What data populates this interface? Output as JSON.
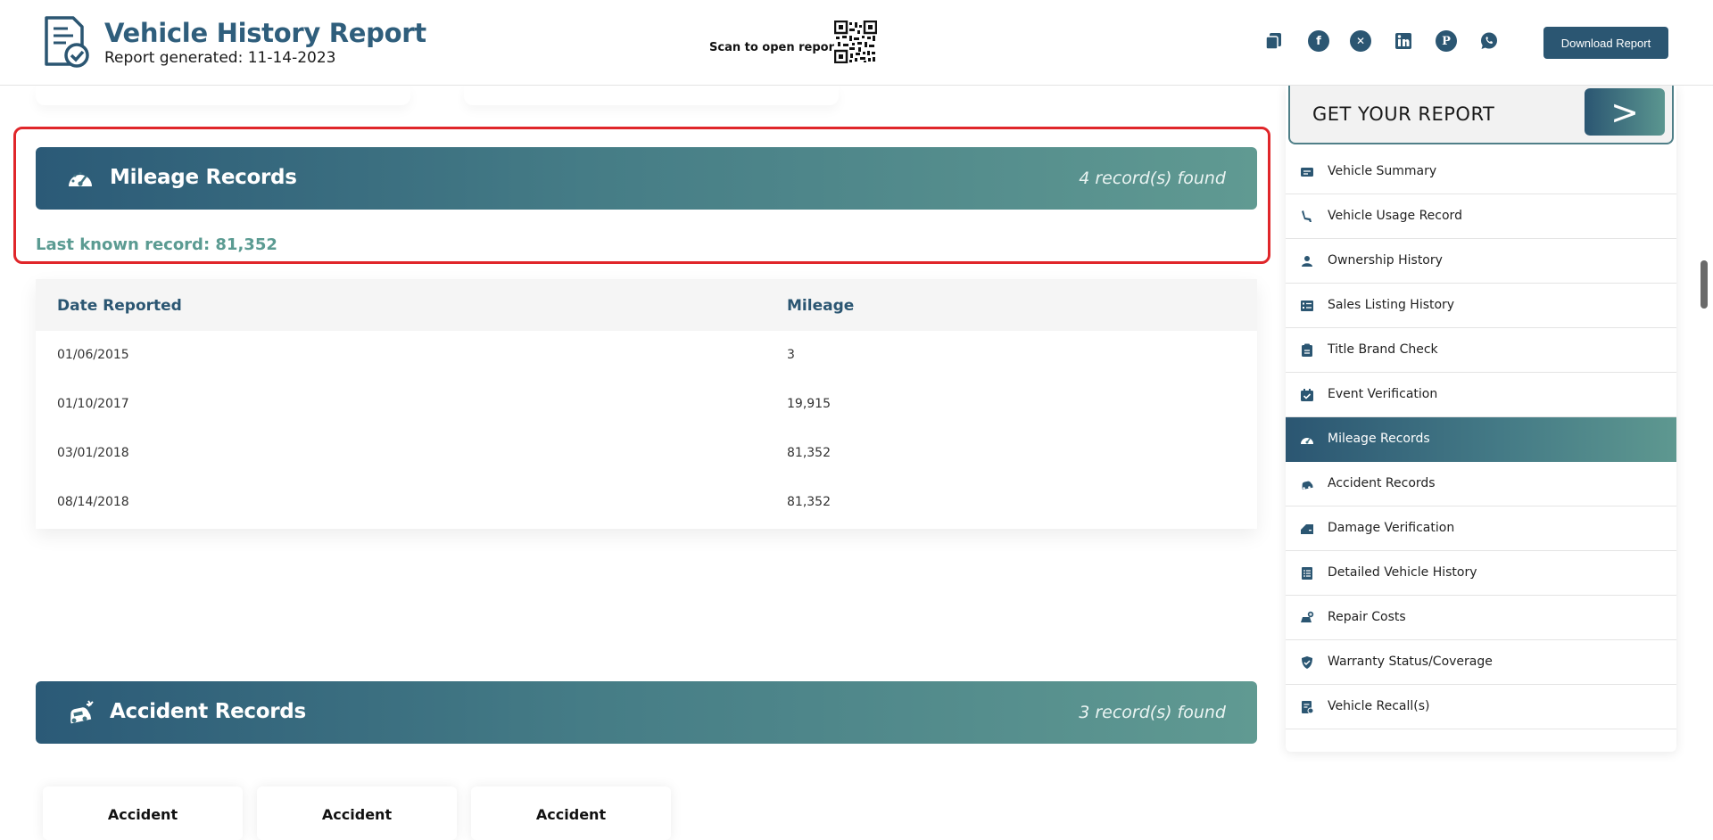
{
  "header": {
    "title": "Vehicle History Report",
    "subtitle": "Report generated: 11-14-2023",
    "scan_label": "Scan to open report:",
    "download_label": "Download Report",
    "share_icons": [
      "copy-icon",
      "facebook-icon",
      "x-icon",
      "linkedin-icon",
      "pinterest-icon",
      "whatsapp-icon"
    ]
  },
  "mileage": {
    "title": "Mileage Records",
    "count": "4 record(s) found",
    "last_known": "Last known record: 81,352",
    "columns": [
      "Date Reported",
      "Mileage"
    ],
    "rows": [
      {
        "date": "01/06/2015",
        "mileage": "3"
      },
      {
        "date": "01/10/2017",
        "mileage": "19,915"
      },
      {
        "date": "03/01/2018",
        "mileage": "81,352"
      },
      {
        "date": "08/14/2018",
        "mileage": "81,352"
      }
    ]
  },
  "accident": {
    "title": "Accident Records",
    "count": "3 record(s) found",
    "cards": [
      "Accident",
      "Accident",
      "Accident"
    ]
  },
  "sidebar": {
    "cta": "GET YOUR REPORT",
    "cta_arrow": ">",
    "items": [
      {
        "label": "Vehicle Summary",
        "icon": "summary-card-icon"
      },
      {
        "label": "Vehicle Usage Record",
        "icon": "seat-icon"
      },
      {
        "label": "Ownership History",
        "icon": "person-icon"
      },
      {
        "label": "Sales Listing History",
        "icon": "list-icon"
      },
      {
        "label": "Title Brand Check",
        "icon": "clipboard-icon"
      },
      {
        "label": "Event Verification",
        "icon": "calendar-check-icon"
      },
      {
        "label": "Mileage Records",
        "icon": "gauge-icon"
      },
      {
        "label": "Accident Records",
        "icon": "car-crash-icon"
      },
      {
        "label": "Damage Verification",
        "icon": "car-door-icon"
      },
      {
        "label": "Detailed Vehicle History",
        "icon": "detail-list-icon"
      },
      {
        "label": "Repair Costs",
        "icon": "repair-icon"
      },
      {
        "label": "Warranty Status/Coverage",
        "icon": "shield-check-icon"
      },
      {
        "label": "Vehicle Recall(s)",
        "icon": "recall-icon"
      }
    ],
    "active_index": 6
  },
  "colors": {
    "primary": "#2b5672",
    "accent": "#5e9890",
    "highlight": "#e0262a"
  }
}
